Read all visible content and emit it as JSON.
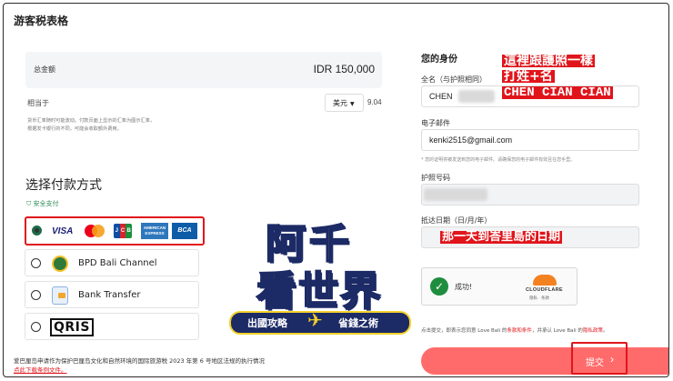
{
  "page_title": "游客税表格",
  "summary": {
    "total_label": "总金额",
    "total_amount": "IDR 150,000",
    "equiv_label": "相当于",
    "currency": "美元",
    "equiv_value": "9.04",
    "disclaimer_line1": "货币汇率随时可能波动。付款页面上显示的汇率为图示汇率，",
    "disclaimer_line2": "根据发卡银行的不同，可能会收取额外费用。"
  },
  "payment": {
    "title": "选择付款方式",
    "secure_label": "安全支付",
    "options": [
      {
        "label": "",
        "selected": true
      },
      {
        "label": "BPD Bali Channel",
        "selected": false
      },
      {
        "label": "Bank Transfer",
        "selected": false
      },
      {
        "label": "QRIS",
        "selected": false
      }
    ],
    "card_logos": [
      "VISA",
      "JCB",
      "AMERICAN EXPRESS",
      "BCA"
    ]
  },
  "footer": {
    "text": "爱巴厘岛申请作为保护巴厘岛文化和自然环境的国际旅游税 2023 年第 6 号地区法规的执行情况",
    "link": "点此下载条例文件。"
  },
  "identity": {
    "title": "您的身份",
    "fullname_label": "全名（与护照相同）",
    "fullname_value": "CHEN",
    "email_label": "电子邮件",
    "email_value": "kenki2515@gmail.com",
    "email_hint": "* 您的证明将被发送到您的电子邮件。请确保您的电子邮件有效且在您手里。",
    "passport_label": "护照号码",
    "arrival_label": "抵达日期（日/月/年）"
  },
  "captcha": {
    "status": "成功!",
    "brand": "CLOUDFLARE",
    "links": "隐私 · 条款"
  },
  "terms": {
    "prefix": "点击提交，即表示您同意 Love Bali 的",
    "terms_link": "条款和条件",
    "middle": "，并承认 Love Bali 的",
    "privacy_link": "隐私政策",
    "suffix": "。"
  },
  "submit": {
    "label": "提交",
    "arrow": "›"
  },
  "annotations": {
    "line1": "這裡跟護照一樣",
    "line2": "打姓+名",
    "line3": "CHEN CIAN CIAN",
    "arrival_note": "那一天到峇里島的日期"
  },
  "watermark": {
    "line1": "阿千",
    "line2": "看世界",
    "banner_left": "出國攻略",
    "banner_right": "省錢之術"
  },
  "colors": {
    "accent": "#ff6b6b",
    "highlight_red": "#e0151b",
    "secure_green": "#2e8b57"
  }
}
